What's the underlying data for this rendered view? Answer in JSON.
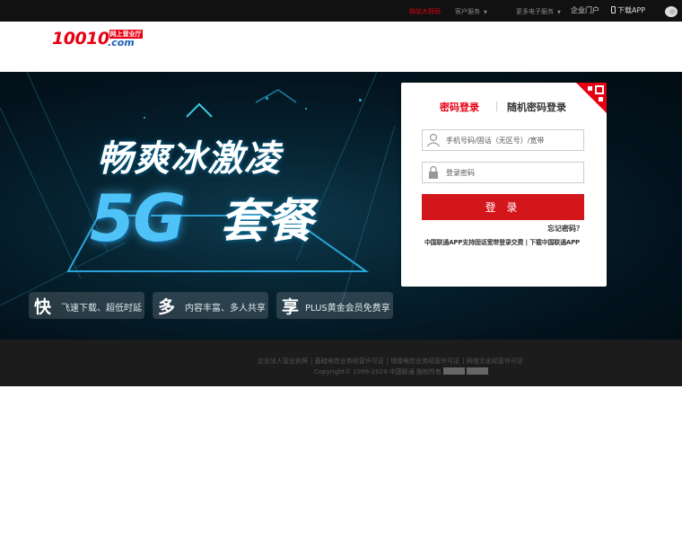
{
  "topbar": {
    "promo": "购站大拜码",
    "customer_service": "客户服务",
    "more_services": "更多电子服务",
    "enterprise": "企业门户",
    "download_app": "下载APP"
  },
  "header": {
    "logo_number": "10010",
    "logo_cn": "网上营业厅",
    "logo_domain": ".com"
  },
  "banner": {
    "headline": "畅爽冰激凌",
    "big_text": "5G",
    "package_text": "套餐",
    "features": [
      {
        "char": "快",
        "text": "飞速下载、超低时延"
      },
      {
        "char": "多",
        "text": "内容丰富、多人共享"
      },
      {
        "char": "享",
        "text": "PLUS黄金会员免费享"
      }
    ]
  },
  "login": {
    "tab_password": "密码登录",
    "tab_random": "随机密码登录",
    "phone_placeholder": "手机号码/固话（无区号）/宽带",
    "password_placeholder": "登录密码",
    "submit": "登 录",
    "forgot": "忘记密码？",
    "notice": "中国联通APP支持固话宽带登录交费 | 下载中国联通APP"
  },
  "footer": {
    "links": [
      "企业法人营业执照",
      "基础电信业务经营许可证",
      "增值电信业务经营许可证",
      "网络文化经营许可证"
    ],
    "copyright": "Copyright© 1999-2024 中国联通 版权所有"
  },
  "colors": {
    "brand_red": "#e60012",
    "login_button": "#d3151c",
    "banner_accent": "#4fc3f7"
  }
}
